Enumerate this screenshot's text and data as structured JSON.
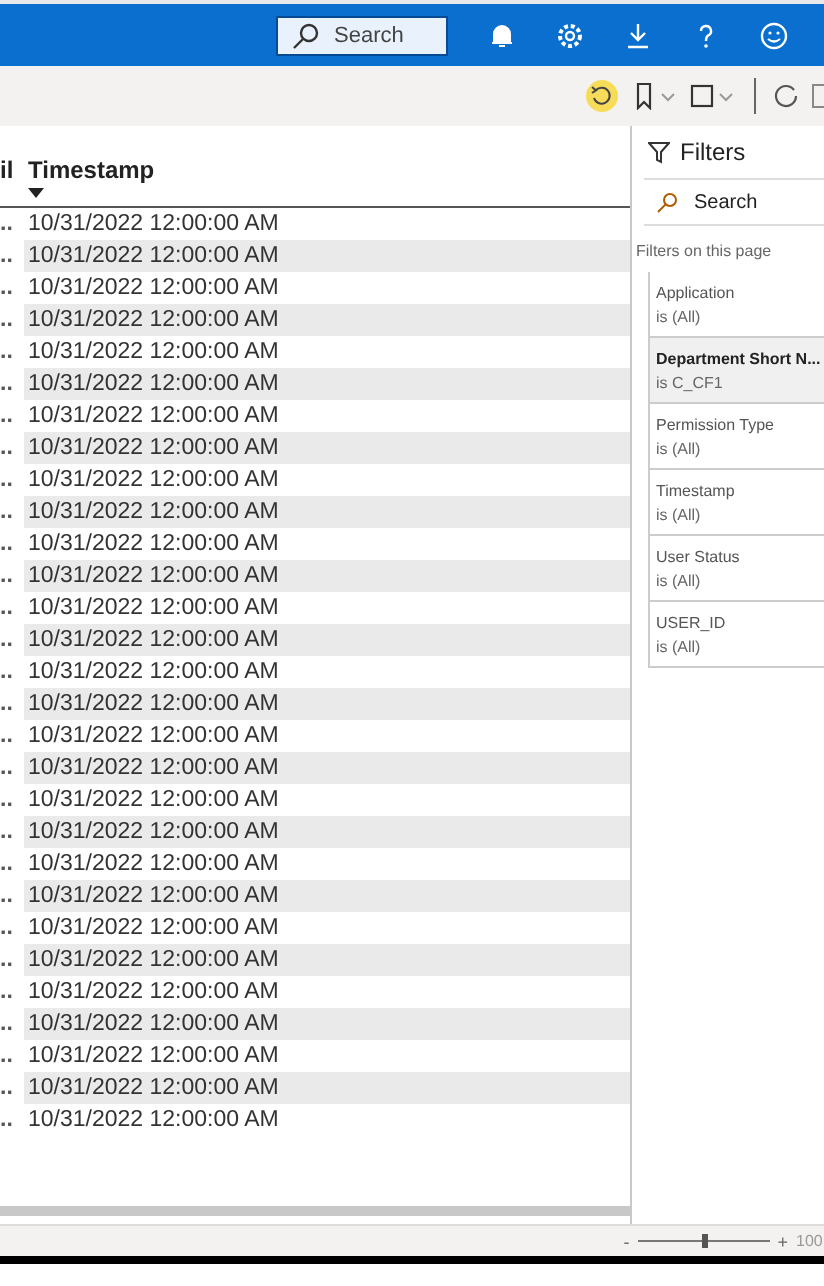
{
  "topbar": {
    "search": {
      "placeholder": "Search"
    }
  },
  "toolbar": {
    "reset_highlighted": true
  },
  "table": {
    "columns": [
      {
        "label": "il",
        "sorted": false
      },
      {
        "label": "Timestamp",
        "sorted": true
      }
    ],
    "rows": [
      {
        "cells": [
          "..",
          "10/31/2022 12:00:00 AM"
        ]
      },
      {
        "cells": [
          "..",
          "10/31/2022 12:00:00 AM"
        ]
      },
      {
        "cells": [
          "..",
          "10/31/2022 12:00:00 AM"
        ]
      },
      {
        "cells": [
          "..",
          "10/31/2022 12:00:00 AM"
        ]
      },
      {
        "cells": [
          "..",
          "10/31/2022 12:00:00 AM"
        ]
      },
      {
        "cells": [
          "..",
          "10/31/2022 12:00:00 AM"
        ]
      },
      {
        "cells": [
          "..",
          "10/31/2022 12:00:00 AM"
        ]
      },
      {
        "cells": [
          "..",
          "10/31/2022 12:00:00 AM"
        ]
      },
      {
        "cells": [
          "..",
          "10/31/2022 12:00:00 AM"
        ]
      },
      {
        "cells": [
          "..",
          "10/31/2022 12:00:00 AM"
        ]
      },
      {
        "cells": [
          "..",
          "10/31/2022 12:00:00 AM"
        ]
      },
      {
        "cells": [
          "..",
          "10/31/2022 12:00:00 AM"
        ]
      },
      {
        "cells": [
          "..",
          "10/31/2022 12:00:00 AM"
        ]
      },
      {
        "cells": [
          "..",
          "10/31/2022 12:00:00 AM"
        ]
      },
      {
        "cells": [
          "..",
          "10/31/2022 12:00:00 AM"
        ]
      },
      {
        "cells": [
          "..",
          "10/31/2022 12:00:00 AM"
        ]
      },
      {
        "cells": [
          "..",
          "10/31/2022 12:00:00 AM"
        ]
      },
      {
        "cells": [
          "..",
          "10/31/2022 12:00:00 AM"
        ]
      },
      {
        "cells": [
          "..",
          "10/31/2022 12:00:00 AM"
        ]
      },
      {
        "cells": [
          "..",
          "10/31/2022 12:00:00 AM"
        ]
      },
      {
        "cells": [
          "..",
          "10/31/2022 12:00:00 AM"
        ]
      },
      {
        "cells": [
          "..",
          "10/31/2022 12:00:00 AM"
        ]
      },
      {
        "cells": [
          "..",
          "10/31/2022 12:00:00 AM"
        ]
      },
      {
        "cells": [
          "..",
          "10/31/2022 12:00:00 AM"
        ]
      },
      {
        "cells": [
          "..",
          "10/31/2022 12:00:00 AM"
        ]
      },
      {
        "cells": [
          "..",
          "10/31/2022 12:00:00 AM"
        ]
      },
      {
        "cells": [
          "..",
          "10/31/2022 12:00:00 AM"
        ]
      },
      {
        "cells": [
          "..",
          "10/31/2022 12:00:00 AM"
        ]
      },
      {
        "cells": [
          "..",
          "10/31/2022 12:00:00 AM"
        ]
      }
    ]
  },
  "filters": {
    "title": "Filters",
    "search": {
      "placeholder": "Search"
    },
    "section": "Filters on this page",
    "cards": [
      {
        "name": "Application",
        "value": "is (All)",
        "applied": false
      },
      {
        "name": "Department Short N...",
        "value": "is C_CF1",
        "applied": true
      },
      {
        "name": "Permission Type",
        "value": "is (All)",
        "applied": false
      },
      {
        "name": "Timestamp",
        "value": "is (All)",
        "applied": false
      },
      {
        "name": "User Status",
        "value": "is (All)",
        "applied": false
      },
      {
        "name": "USER_ID",
        "value": "is (All)",
        "applied": false
      }
    ]
  },
  "status_bar": {
    "zoom": {
      "minus": "-",
      "plus": "+",
      "level": 0.5,
      "reading": "100"
    }
  }
}
